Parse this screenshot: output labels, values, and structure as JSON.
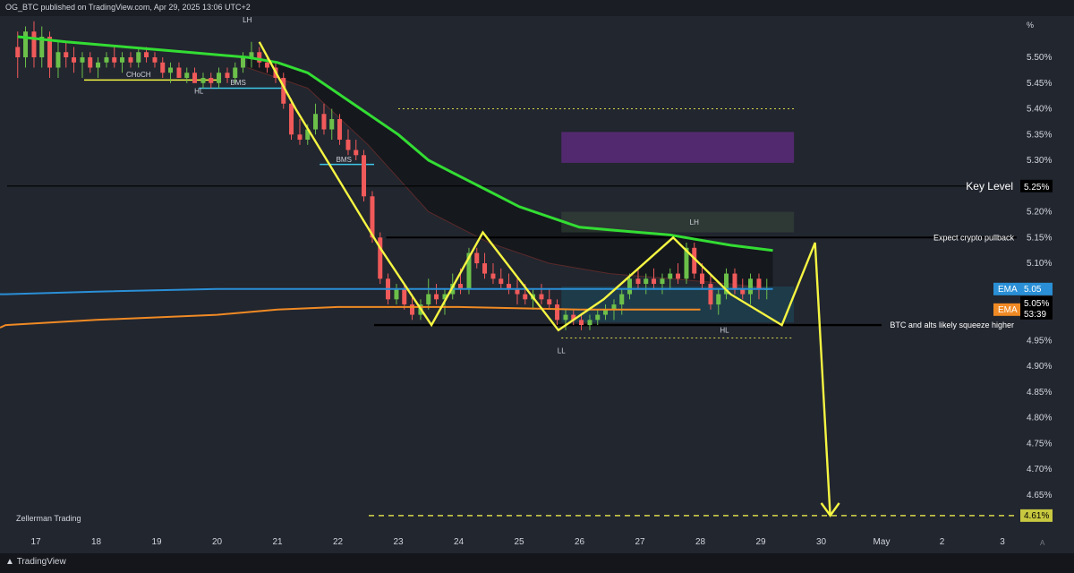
{
  "header": {
    "publisher": "OG_BTC published on TradingView.com, Apr 29, 2025 13:06 UTC+2"
  },
  "footer": {
    "brand": "TradingView",
    "watermark": "Zellerman Trading"
  },
  "colors": {
    "bg": "#22262f",
    "grid": "#2e323c",
    "up": "#6cc04a",
    "down": "#f05a5a",
    "ema_green": "#33dd33",
    "ema_blue": "#2a8fd6",
    "ema_orange": "#f08a24",
    "pattern": "#f5f542",
    "target": "#d8d84a",
    "box": "#5b2a79"
  },
  "chart_data": {
    "type": "candlestick",
    "title": "",
    "xlabel": "",
    "ylabel": "",
    "y_unit_label": "%",
    "ylim": [
      4.575,
      5.58
    ],
    "x_ticks": [
      "17",
      "18",
      "19",
      "20",
      "21",
      "22",
      "23",
      "24",
      "25",
      "26",
      "27",
      "28",
      "29",
      "30",
      "May",
      "2",
      "3"
    ],
    "y_ticks": [
      "5.50%",
      "5.45%",
      "5.40%",
      "5.35%",
      "5.30%",
      "5.25%",
      "5.20%",
      "5.15%",
      "5.10%",
      "5.05%",
      "4.95%",
      "4.90%",
      "4.85%",
      "4.80%",
      "4.75%",
      "4.70%",
      "4.65%"
    ],
    "grid": false,
    "ohlc": [
      [
        16.7,
        5.52,
        5.55,
        5.46,
        5.5
      ],
      [
        16.83,
        5.5,
        5.56,
        5.48,
        5.55
      ],
      [
        16.97,
        5.55,
        5.57,
        5.48,
        5.5
      ],
      [
        17.1,
        5.5,
        5.56,
        5.48,
        5.54
      ],
      [
        17.23,
        5.54,
        5.55,
        5.46,
        5.48
      ],
      [
        17.37,
        5.48,
        5.53,
        5.46,
        5.51
      ],
      [
        17.5,
        5.51,
        5.53,
        5.48,
        5.5
      ],
      [
        17.63,
        5.5,
        5.52,
        5.47,
        5.49
      ],
      [
        17.77,
        5.49,
        5.51,
        5.46,
        5.5
      ],
      [
        17.9,
        5.5,
        5.51,
        5.47,
        5.48
      ],
      [
        18.03,
        5.48,
        5.5,
        5.46,
        5.49
      ],
      [
        18.17,
        5.49,
        5.51,
        5.48,
        5.5
      ],
      [
        18.3,
        5.5,
        5.52,
        5.48,
        5.49
      ],
      [
        18.43,
        5.49,
        5.51,
        5.47,
        5.5
      ],
      [
        18.57,
        5.5,
        5.51,
        5.48,
        5.49
      ],
      [
        18.7,
        5.49,
        5.52,
        5.48,
        5.51
      ],
      [
        18.83,
        5.51,
        5.52,
        5.49,
        5.5
      ],
      [
        18.97,
        5.5,
        5.51,
        5.48,
        5.49
      ],
      [
        19.1,
        5.49,
        5.5,
        5.46,
        5.47
      ],
      [
        19.23,
        5.47,
        5.49,
        5.45,
        5.48
      ],
      [
        19.37,
        5.48,
        5.49,
        5.46,
        5.46
      ],
      [
        19.5,
        5.46,
        5.48,
        5.45,
        5.47
      ],
      [
        19.63,
        5.47,
        5.48,
        5.45,
        5.45
      ],
      [
        19.77,
        5.45,
        5.47,
        5.44,
        5.46
      ],
      [
        19.9,
        5.46,
        5.47,
        5.44,
        5.45
      ],
      [
        20.03,
        5.45,
        5.48,
        5.44,
        5.47
      ],
      [
        20.17,
        5.47,
        5.48,
        5.45,
        5.46
      ],
      [
        20.3,
        5.46,
        5.49,
        5.45,
        5.48
      ],
      [
        20.43,
        5.48,
        5.51,
        5.47,
        5.5
      ],
      [
        20.57,
        5.5,
        5.53,
        5.48,
        5.51
      ],
      [
        20.7,
        5.51,
        5.52,
        5.48,
        5.49
      ],
      [
        20.83,
        5.49,
        5.5,
        5.47,
        5.48
      ],
      [
        20.97,
        5.48,
        5.49,
        5.45,
        5.46
      ],
      [
        21.1,
        5.46,
        5.47,
        5.4,
        5.41
      ],
      [
        21.23,
        5.41,
        5.42,
        5.34,
        5.35
      ],
      [
        21.37,
        5.35,
        5.38,
        5.33,
        5.34
      ],
      [
        21.5,
        5.34,
        5.37,
        5.33,
        5.36
      ],
      [
        21.63,
        5.36,
        5.41,
        5.35,
        5.39
      ],
      [
        21.77,
        5.39,
        5.41,
        5.35,
        5.36
      ],
      [
        21.9,
        5.36,
        5.4,
        5.34,
        5.38
      ],
      [
        22.03,
        5.38,
        5.39,
        5.33,
        5.34
      ],
      [
        22.17,
        5.34,
        5.36,
        5.31,
        5.32
      ],
      [
        22.3,
        5.32,
        5.34,
        5.3,
        5.31
      ],
      [
        22.43,
        5.31,
        5.32,
        5.22,
        5.23
      ],
      [
        22.57,
        5.23,
        5.24,
        5.14,
        5.15
      ],
      [
        22.7,
        5.15,
        5.16,
        5.06,
        5.07
      ],
      [
        22.83,
        5.07,
        5.08,
        5.02,
        5.03
      ],
      [
        22.97,
        5.03,
        5.06,
        5.02,
        5.05
      ],
      [
        23.1,
        5.05,
        5.06,
        5.01,
        5.02
      ],
      [
        23.23,
        5.02,
        5.04,
        4.99,
        5.0
      ],
      [
        23.37,
        5.0,
        5.03,
        4.99,
        5.02
      ],
      [
        23.5,
        5.02,
        5.07,
        5.01,
        5.04
      ],
      [
        23.63,
        5.04,
        5.06,
        5.02,
        5.03
      ],
      [
        23.77,
        5.03,
        5.05,
        5.0,
        5.04
      ],
      [
        23.9,
        5.04,
        5.08,
        5.03,
        5.06
      ],
      [
        24.03,
        5.06,
        5.09,
        5.04,
        5.05
      ],
      [
        24.17,
        5.05,
        5.13,
        5.04,
        5.12
      ],
      [
        24.3,
        5.12,
        5.13,
        5.09,
        5.1
      ],
      [
        24.43,
        5.1,
        5.12,
        5.07,
        5.08
      ],
      [
        24.57,
        5.08,
        5.1,
        5.06,
        5.07
      ],
      [
        24.7,
        5.07,
        5.09,
        5.05,
        5.06
      ],
      [
        24.83,
        5.06,
        5.08,
        5.04,
        5.05
      ],
      [
        24.97,
        5.05,
        5.07,
        5.02,
        5.04
      ],
      [
        25.1,
        5.04,
        5.06,
        5.02,
        5.03
      ],
      [
        25.23,
        5.03,
        5.05,
        5.01,
        5.04
      ],
      [
        25.37,
        5.04,
        5.06,
        5.02,
        5.03
      ],
      [
        25.5,
        5.03,
        5.05,
        5.01,
        5.02
      ],
      [
        25.63,
        5.02,
        5.03,
        4.98,
        4.99
      ],
      [
        25.77,
        4.99,
        5.01,
        4.97,
        5.0
      ],
      [
        25.9,
        5.0,
        5.01,
        4.98,
        4.99
      ],
      [
        26.03,
        4.99,
        5.0,
        4.97,
        4.98
      ],
      [
        26.17,
        4.98,
        5.0,
        4.97,
        4.99
      ],
      [
        26.3,
        4.99,
        5.01,
        4.98,
        5.0
      ],
      [
        26.43,
        5.0,
        5.02,
        4.99,
        5.01
      ],
      [
        26.57,
        5.01,
        5.03,
        4.99,
        5.02
      ],
      [
        26.7,
        5.02,
        5.05,
        5.0,
        5.04
      ],
      [
        26.83,
        5.04,
        5.08,
        5.03,
        5.07
      ],
      [
        26.97,
        5.07,
        5.09,
        5.05,
        5.06
      ],
      [
        27.1,
        5.06,
        5.08,
        5.04,
        5.07
      ],
      [
        27.23,
        5.07,
        5.09,
        5.05,
        5.06
      ],
      [
        27.37,
        5.06,
        5.08,
        5.04,
        5.07
      ],
      [
        27.5,
        5.07,
        5.09,
        5.05,
        5.08
      ],
      [
        27.63,
        5.08,
        5.1,
        5.06,
        5.07
      ],
      [
        27.77,
        5.07,
        5.14,
        5.06,
        5.13
      ],
      [
        27.9,
        5.13,
        5.14,
        5.07,
        5.08
      ],
      [
        28.03,
        5.08,
        5.1,
        5.05,
        5.06
      ],
      [
        28.17,
        5.06,
        5.08,
        5.01,
        5.02
      ],
      [
        28.3,
        5.02,
        5.05,
        5.0,
        5.04
      ],
      [
        28.43,
        5.04,
        5.09,
        5.03,
        5.08
      ],
      [
        28.57,
        5.08,
        5.09,
        5.04,
        5.05
      ],
      [
        28.7,
        5.05,
        5.07,
        5.03,
        5.04
      ],
      [
        28.83,
        5.04,
        5.08,
        5.02,
        5.07
      ],
      [
        28.97,
        5.07,
        5.08,
        5.03,
        5.05
      ],
      [
        29.1,
        5.05,
        5.07,
        5.03,
        5.05
      ]
    ],
    "ema_green": [
      [
        16.7,
        5.54
      ],
      [
        17.5,
        5.53
      ],
      [
        18.5,
        5.52
      ],
      [
        19.5,
        5.51
      ],
      [
        20.5,
        5.5
      ],
      [
        21.0,
        5.49
      ],
      [
        21.5,
        5.47
      ],
      [
        22.0,
        5.43
      ],
      [
        22.5,
        5.39
      ],
      [
        23.0,
        5.35
      ],
      [
        23.5,
        5.3
      ],
      [
        24.0,
        5.27
      ],
      [
        24.5,
        5.24
      ],
      [
        25.0,
        5.21
      ],
      [
        25.5,
        5.19
      ],
      [
        26.0,
        5.17
      ],
      [
        26.5,
        5.165
      ],
      [
        27.0,
        5.16
      ],
      [
        27.5,
        5.155
      ],
      [
        28.0,
        5.145
      ],
      [
        28.5,
        5.135
      ],
      [
        29.2,
        5.125
      ]
    ],
    "ema_dark_band": [
      [
        20.5,
        5.48
      ],
      [
        21.5,
        5.44
      ],
      [
        22.5,
        5.33
      ],
      [
        23.5,
        5.2
      ],
      [
        24.5,
        5.14
      ],
      [
        25.5,
        5.1
      ],
      [
        26.5,
        5.08
      ],
      [
        27.5,
        5.07
      ],
      [
        28.5,
        5.06
      ],
      [
        29.2,
        5.05
      ]
    ],
    "ema_blue": [
      [
        16.5,
        5.04
      ],
      [
        18.0,
        5.045
      ],
      [
        20.0,
        5.05
      ],
      [
        22.0,
        5.05
      ],
      [
        24.0,
        5.05
      ],
      [
        26.0,
        5.05
      ],
      [
        28.0,
        5.05
      ],
      [
        29.2,
        5.05
      ]
    ],
    "ema_orange": [
      [
        16.5,
        4.98
      ],
      [
        18.0,
        4.99
      ],
      [
        20.0,
        5.0
      ],
      [
        21.0,
        5.01
      ],
      [
        22.0,
        5.015
      ],
      [
        24.0,
        5.015
      ],
      [
        26.0,
        5.01
      ],
      [
        27.0,
        5.01
      ],
      [
        28.0,
        5.01
      ]
    ],
    "pattern_path": [
      [
        20.7,
        5.53
      ],
      [
        21.3,
        5.4
      ],
      [
        22.7,
        5.13
      ],
      [
        23.55,
        4.98
      ],
      [
        24.4,
        5.16
      ],
      [
        25.65,
        4.97
      ],
      [
        26.4,
        5.03
      ],
      [
        27.55,
        5.15
      ],
      [
        28.5,
        5.04
      ],
      [
        29.35,
        4.98
      ],
      [
        29.9,
        5.14
      ],
      [
        30.15,
        4.61
      ]
    ],
    "hlines": {
      "key_level": 5.25,
      "expect_pullback": 5.15,
      "squeeze_support": 4.98,
      "target": 4.61,
      "dotted_upper": 5.4,
      "dotted_lower": 4.955,
      "choch": 5.456,
      "bms1": 5.44,
      "bms2": 5.292
    },
    "price_tags": {
      "ema_blue": "5.05",
      "ema_orange": "5.01",
      "last_price": "5.05%",
      "countdown": "53:39",
      "target": "4.61%",
      "key_level": "5.25%",
      "ema_label": "EMA"
    },
    "annotations": {
      "lh1": "LH",
      "lh2": "LH",
      "hl1": "HL",
      "hl2": "HL",
      "ll": "LL",
      "choch": "CHoCH",
      "bms1": "BMS",
      "bms2": "BMS",
      "key_level": "Key Level",
      "expect_pullback": "Expect crypto pullback",
      "squeeze": "BTC and alts likely squeeze higher"
    }
  }
}
